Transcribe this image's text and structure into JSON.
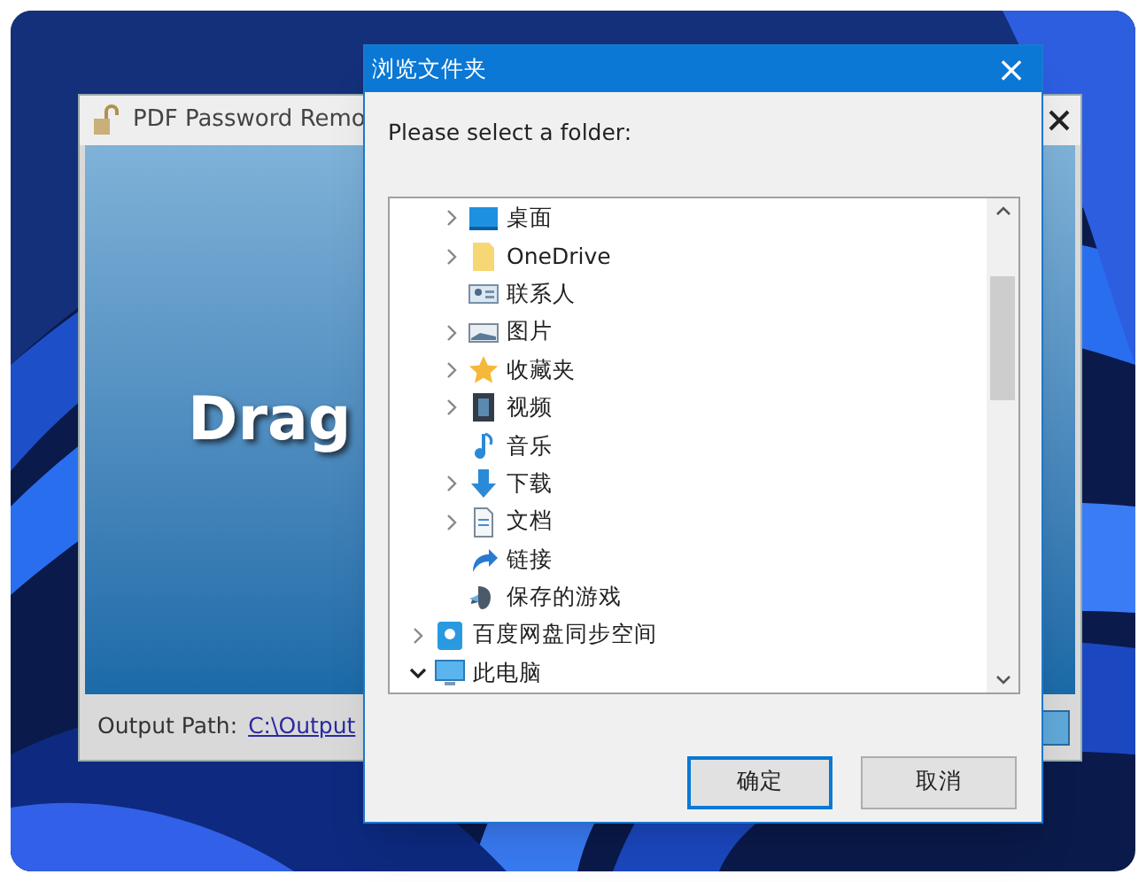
{
  "background_window": {
    "title": "PDF Password Remo",
    "drop_text": "Drag",
    "output_label": "Output Path:",
    "output_link": "C:\\Output"
  },
  "dialog": {
    "title": "浏览文件夹",
    "close": "×",
    "prompt": "Please select a folder:",
    "tree": {
      "nested_items": [
        {
          "label": "桌面",
          "kind": "desktop",
          "expandable": true,
          "expanded": false
        },
        {
          "label": "OneDrive",
          "kind": "folder",
          "expandable": true,
          "expanded": false
        },
        {
          "label": "联系人",
          "kind": "contacts",
          "expandable": false
        },
        {
          "label": "图片",
          "kind": "pictures",
          "expandable": true,
          "expanded": false
        },
        {
          "label": "收藏夹",
          "kind": "favorites",
          "expandable": true,
          "expanded": false
        },
        {
          "label": "视频",
          "kind": "videos",
          "expandable": true,
          "expanded": false
        },
        {
          "label": "音乐",
          "kind": "music",
          "expandable": false
        },
        {
          "label": "下载",
          "kind": "downloads",
          "expandable": true,
          "expanded": false
        },
        {
          "label": "文档",
          "kind": "documents",
          "expandable": true,
          "expanded": false
        },
        {
          "label": "链接",
          "kind": "links",
          "expandable": false
        },
        {
          "label": "保存的游戏",
          "kind": "games",
          "expandable": false
        }
      ],
      "items": [
        {
          "label": "百度网盘同步空间",
          "kind": "cloud",
          "expandable": true,
          "expanded": false
        },
        {
          "label": "此电脑",
          "kind": "computer",
          "expandable": true,
          "expanded": true
        }
      ]
    },
    "buttons": [
      {
        "label": "确定",
        "default": true
      },
      {
        "label": "取消",
        "default": false
      }
    ]
  }
}
